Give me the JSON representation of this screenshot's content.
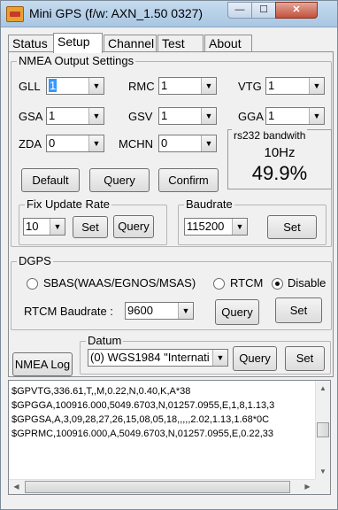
{
  "window": {
    "title": "Mini GPS (f/w: AXN_1.50 0327)",
    "controls": {
      "minimize": "—",
      "maximize": "☐",
      "close": "✕"
    }
  },
  "tabs": [
    "Status",
    "Setup",
    "Channel",
    "Test",
    "About"
  ],
  "active_tab": "Setup",
  "nmea": {
    "group_label": "NMEA Output Settings",
    "fields": [
      {
        "label": "GLL",
        "value": "1"
      },
      {
        "label": "RMC",
        "value": "1"
      },
      {
        "label": "VTG",
        "value": "1"
      },
      {
        "label": "GSA",
        "value": "1"
      },
      {
        "label": "GSV",
        "value": "1"
      },
      {
        "label": "GGA",
        "value": "1"
      },
      {
        "label": "ZDA",
        "value": "0"
      },
      {
        "label": "MCHN",
        "value": "0"
      }
    ],
    "buttons": {
      "default": "Default",
      "query": "Query",
      "confirm": "Confirm"
    }
  },
  "bandwidth": {
    "label": "rs232 bandwith",
    "rate": "10Hz",
    "percent": "49.9%"
  },
  "fix_update": {
    "group_label": "Fix Update Rate",
    "value": "10",
    "set": "Set",
    "query": "Query"
  },
  "baudrate": {
    "group_label": "Baudrate",
    "value": "115200",
    "set": "Set"
  },
  "dgps": {
    "group_label": "DGPS",
    "options": [
      "SBAS(WAAS/EGNOS/MSAS)",
      "RTCM",
      "Disable"
    ],
    "selected": "Disable",
    "rtcm_label": "RTCM Baudrate :",
    "rtcm_value": "9600",
    "query": "Query",
    "set": "Set"
  },
  "nmea_log_button": "NMEA Log",
  "datum": {
    "group_label": "Datum",
    "value": "(0) WGS1984 \"Internati",
    "query": "Query",
    "set": "Set"
  },
  "log_lines": [
    "$GPVTG,336.61,T,,M,0.22,N,0.40,K,A*38",
    "$GPGGA,100916.000,5049.6703,N,01257.0955,E,1,8,1.13,3",
    "$GPGSA,A,3,09,28,27,26,15,08,05,18,,,,,2.02,1.13,1.68*0C",
    "$GPRMC,100916.000,A,5049.6703,N,01257.0955,E,0.22,33"
  ],
  "icons": {
    "dropdown": "chevron-down-icon",
    "scroll_up": "arrow-up-icon",
    "scroll_down": "arrow-down-icon",
    "scroll_left": "arrow-left-icon",
    "scroll_right": "arrow-right-icon"
  }
}
